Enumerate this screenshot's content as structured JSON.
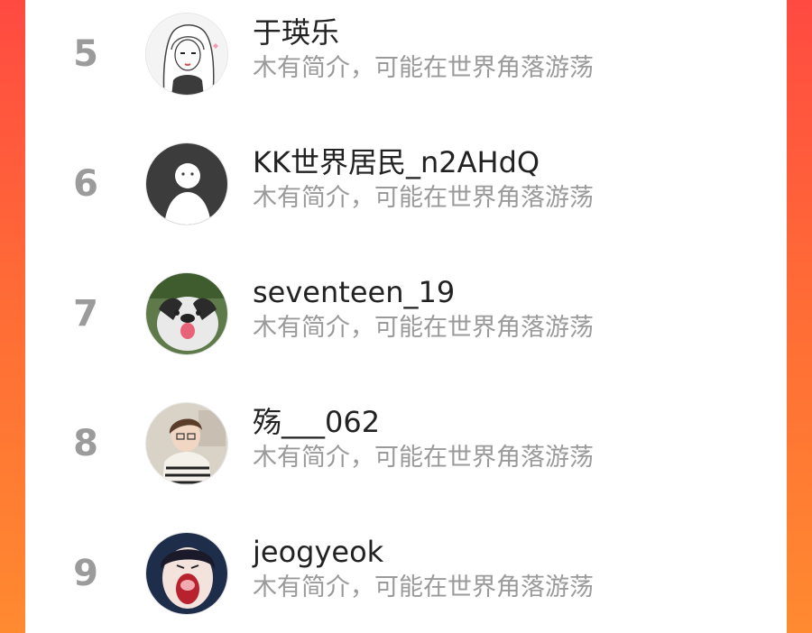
{
  "theme": {
    "accent_start": "#ff4a42",
    "accent_end": "#ff8a30",
    "card_bg": "#ffffff",
    "rank_color": "#9b9b9b",
    "name_color": "#222222",
    "bio_color": "#9a9a9a"
  },
  "ranking": {
    "items": [
      {
        "rank": "5",
        "name": "于瑛乐",
        "bio": "木有简介，可能在世界角落游荡",
        "avatar_icon": "sketch-girl-avatar-icon"
      },
      {
        "rank": "6",
        "name": "KK世界居民_n2AHdQ",
        "bio": "木有简介，可能在世界角落游荡",
        "avatar_icon": "default-user-avatar-icon"
      },
      {
        "rank": "7",
        "name": "seventeen_19",
        "bio": "木有简介，可能在世界角落游荡",
        "avatar_icon": "dog-photo-avatar-icon"
      },
      {
        "rank": "8",
        "name": "殇___062",
        "bio": "木有简介，可能在世界角落游荡",
        "avatar_icon": "girl-photo-avatar-icon"
      },
      {
        "rank": "9",
        "name": "jeogyeok",
        "bio": "木有简介，可能在世界角落游荡",
        "avatar_icon": "screaming-face-avatar-icon"
      }
    ]
  }
}
